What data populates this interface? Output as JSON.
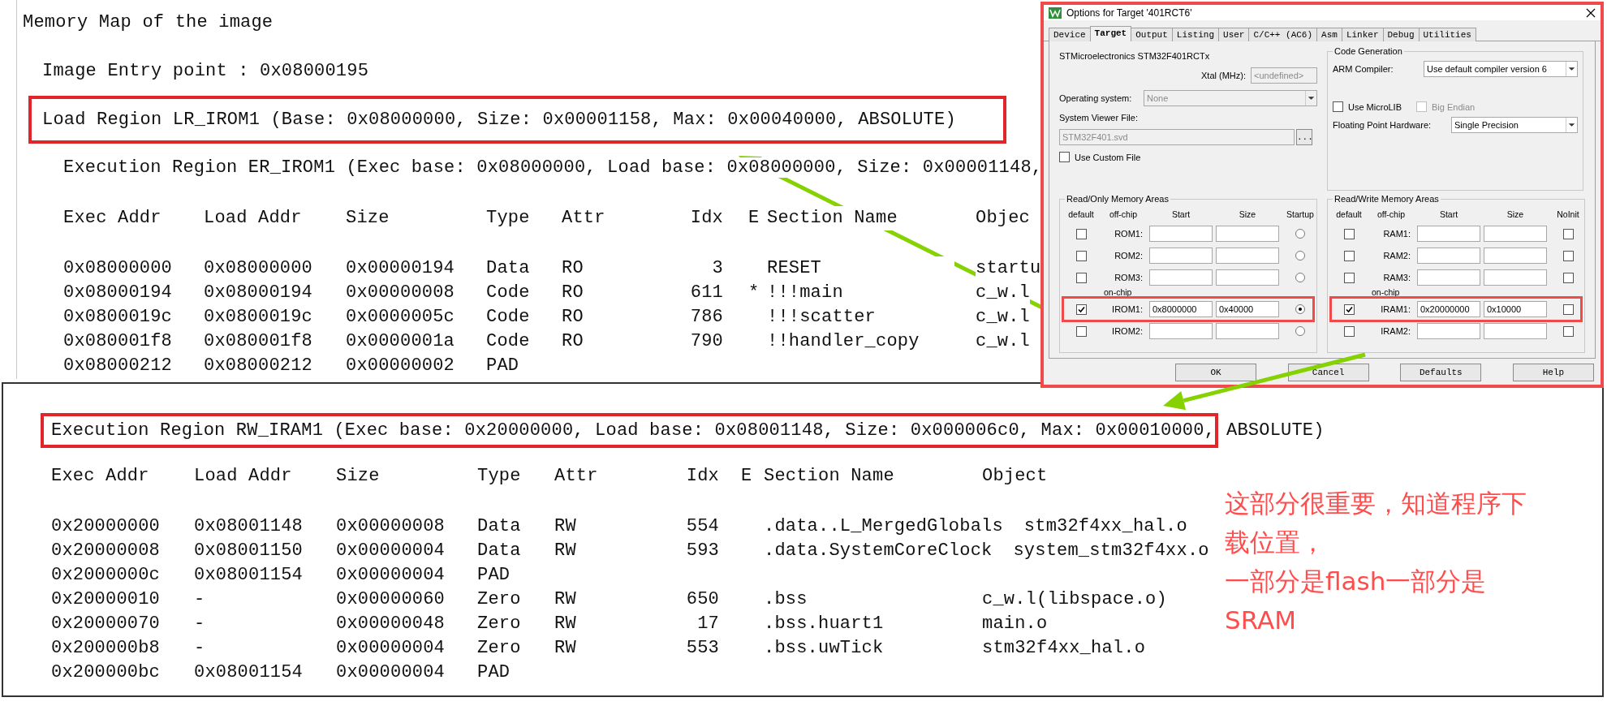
{
  "memory_map": {
    "title": "Memory Map of the image",
    "entry_point": "Image Entry point : 0x08000195",
    "load_region": "Load Region LR_IROM1 (Base: 0x08000000, Size: 0x00001158, Max: 0x00040000, ABSOLUTE)",
    "execution_region": "Execution Region ER_IROM1 (Exec base: 0x08000000, Load base: 0x08000000, Size: 0x00001148,",
    "columns": [
      "Exec Addr",
      "Load Addr",
      "Size",
      "Type",
      "Attr",
      "Idx",
      "E",
      "Section Name",
      "Objec"
    ],
    "rows": [
      {
        "exec_addr": "0x08000000",
        "load_addr": "0x08000000",
        "size": "0x00000194",
        "type": "Data",
        "attr": "RO",
        "idx": "3",
        "section": "RESET",
        "object": "startu"
      },
      {
        "exec_addr": "0x08000194",
        "load_addr": "0x08000194",
        "size": "0x00000008",
        "type": "Code",
        "attr": "RO",
        "idx": "611",
        "entry": "*",
        "section": "!!!main",
        "object": "c_w.l"
      },
      {
        "exec_addr": "0x0800019c",
        "load_addr": "0x0800019c",
        "size": "0x0000005c",
        "type": "Code",
        "attr": "RO",
        "idx": "786",
        "section": "!!!scatter",
        "object": "c_w.l"
      },
      {
        "exec_addr": "0x080001f8",
        "load_addr": "0x080001f8",
        "size": "0x0000001a",
        "type": "Code",
        "attr": "RO",
        "idx": "790",
        "section": "!!handler_copy",
        "object": "c_w.l"
      },
      {
        "exec_addr": "0x08000212",
        "load_addr": "0x08000212",
        "size": "0x00000002",
        "type": "PAD"
      }
    ]
  },
  "ram_region": {
    "execution_region": [
      "Execution Region RW_IRAM1 (Exec base: 0x20000000, Load base: 0x08001148, Size: 0x000006c0, Max: 0x00010000,",
      "ABSOLUTE)"
    ],
    "columns": [
      "Exec Addr",
      "Load Addr",
      "Size",
      "Type",
      "Attr",
      "Idx",
      "E",
      "Section Name",
      "Object"
    ],
    "rows": [
      {
        "exec_addr": "0x20000000",
        "load_addr": "0x08001148",
        "size": "0x00000008",
        "type": "Data",
        "attr": "RW",
        "idx": "554",
        "section": ".data..L_MergedGlobals",
        "object": "stm32f4xx_hal.o"
      },
      {
        "exec_addr": "0x20000008",
        "load_addr": "0x08001150",
        "size": "0x00000004",
        "type": "Data",
        "attr": "RW",
        "idx": "593",
        "section": ".data.SystemCoreClock",
        "object": "system_stm32f4xx.o"
      },
      {
        "exec_addr": "0x2000000c",
        "load_addr": "0x08001154",
        "size": "0x00000004",
        "type": "PAD"
      },
      {
        "exec_addr": "0x20000010",
        "load_addr": "-",
        "size": "0x00000060",
        "type": "Zero",
        "attr": "RW",
        "idx": "650",
        "section": ".bss",
        "object": "c_w.l(libspace.o)"
      },
      {
        "exec_addr": "0x20000070",
        "load_addr": "-",
        "size": "0x00000048",
        "type": "Zero",
        "attr": "RW",
        "idx": "17",
        "section": ".bss.huart1",
        "object": "main.o"
      },
      {
        "exec_addr": "0x200000b8",
        "load_addr": "-",
        "size": "0x00000004",
        "type": "Zero",
        "attr": "RW",
        "idx": "553",
        "section": ".bss.uwTick",
        "object": "stm32f4xx_hal.o"
      },
      {
        "exec_addr": "0x200000bc",
        "load_addr": "0x08001154",
        "size": "0x00000004",
        "type": "PAD"
      }
    ]
  },
  "note": [
    "这部分很重要，知道程序下载位置，",
    "一部分是flash一部分是SRAM"
  ],
  "dialog": {
    "title": "Options for Target '401RCT6'",
    "tabs": [
      {
        "label": "Device",
        "selected": false
      },
      {
        "label": "Target",
        "selected": true
      },
      {
        "label": "Output",
        "selected": false
      },
      {
        "label": "Listing",
        "selected": false
      },
      {
        "label": "User",
        "selected": false
      },
      {
        "label": "C/C++ (AC6)",
        "selected": false
      },
      {
        "label": "Asm",
        "selected": false
      },
      {
        "label": "Linker",
        "selected": false
      },
      {
        "label": "Debug",
        "selected": false
      },
      {
        "label": "Utilities",
        "selected": false
      }
    ],
    "device": "STMicroelectronics STM32F401RCTx",
    "xtal": {
      "label": "Xtal (MHz):",
      "value": "<undefined>",
      "disabled": true
    },
    "operating_system": {
      "label": "Operating system:",
      "value": "None",
      "disabled": true
    },
    "system_viewer_file": {
      "label": "System Viewer File:",
      "value": "STM32F401.svd",
      "disabled": true,
      "browse": "..."
    },
    "use_custom_file": {
      "label": "Use Custom File",
      "checked": false
    },
    "code_generation": {
      "title": "Code Generation",
      "arm_compiler": {
        "label": "ARM Compiler:",
        "value": "Use default compiler version 6"
      },
      "use_microlib": {
        "label": "Use MicroLIB",
        "checked": false
      },
      "big_endian": {
        "label": "Big Endian",
        "checked": false,
        "disabled": true
      },
      "fpu": {
        "label": "Floating Point Hardware:",
        "value": "Single Precision"
      }
    },
    "rom_areas": {
      "title": "Read/Only Memory Areas",
      "columns": [
        "default",
        "off-chip",
        "Start",
        "Size",
        "Startup"
      ],
      "on_chip_label": "on-chip",
      "off_chip": [
        {
          "name": "ROM1:",
          "default": false,
          "selected": false
        },
        {
          "name": "ROM2:",
          "default": false,
          "selected": false
        },
        {
          "name": "ROM3:",
          "default": false,
          "selected": false
        }
      ],
      "on_chip": [
        {
          "name": "IROM1:",
          "default": true,
          "start": "0x8000000",
          "size": "0x40000",
          "selected": true,
          "highlighted": true
        },
        {
          "name": "IROM2:",
          "default": false,
          "selected": false,
          "highlighted": false
        }
      ]
    },
    "ram_areas": {
      "title": "Read/Write Memory Areas",
      "columns": [
        "default",
        "off-chip",
        "Start",
        "Size",
        "NoInit"
      ],
      "on_chip_label": "on-chip",
      "off_chip": [
        {
          "name": "RAM1:",
          "default": false,
          "noinit": false
        },
        {
          "name": "RAM2:",
          "default": false,
          "noinit": false
        },
        {
          "name": "RAM3:",
          "default": false,
          "noinit": false
        }
      ],
      "on_chip": [
        {
          "name": "IRAM1:",
          "default": true,
          "start": "0x20000000",
          "size": "0x10000",
          "noinit": false,
          "highlighted": true
        },
        {
          "name": "IRAM2:",
          "default": false,
          "noinit": false,
          "highlighted": false
        }
      ]
    },
    "buttons": [
      "OK",
      "Cancel",
      "Defaults",
      "Help"
    ]
  }
}
